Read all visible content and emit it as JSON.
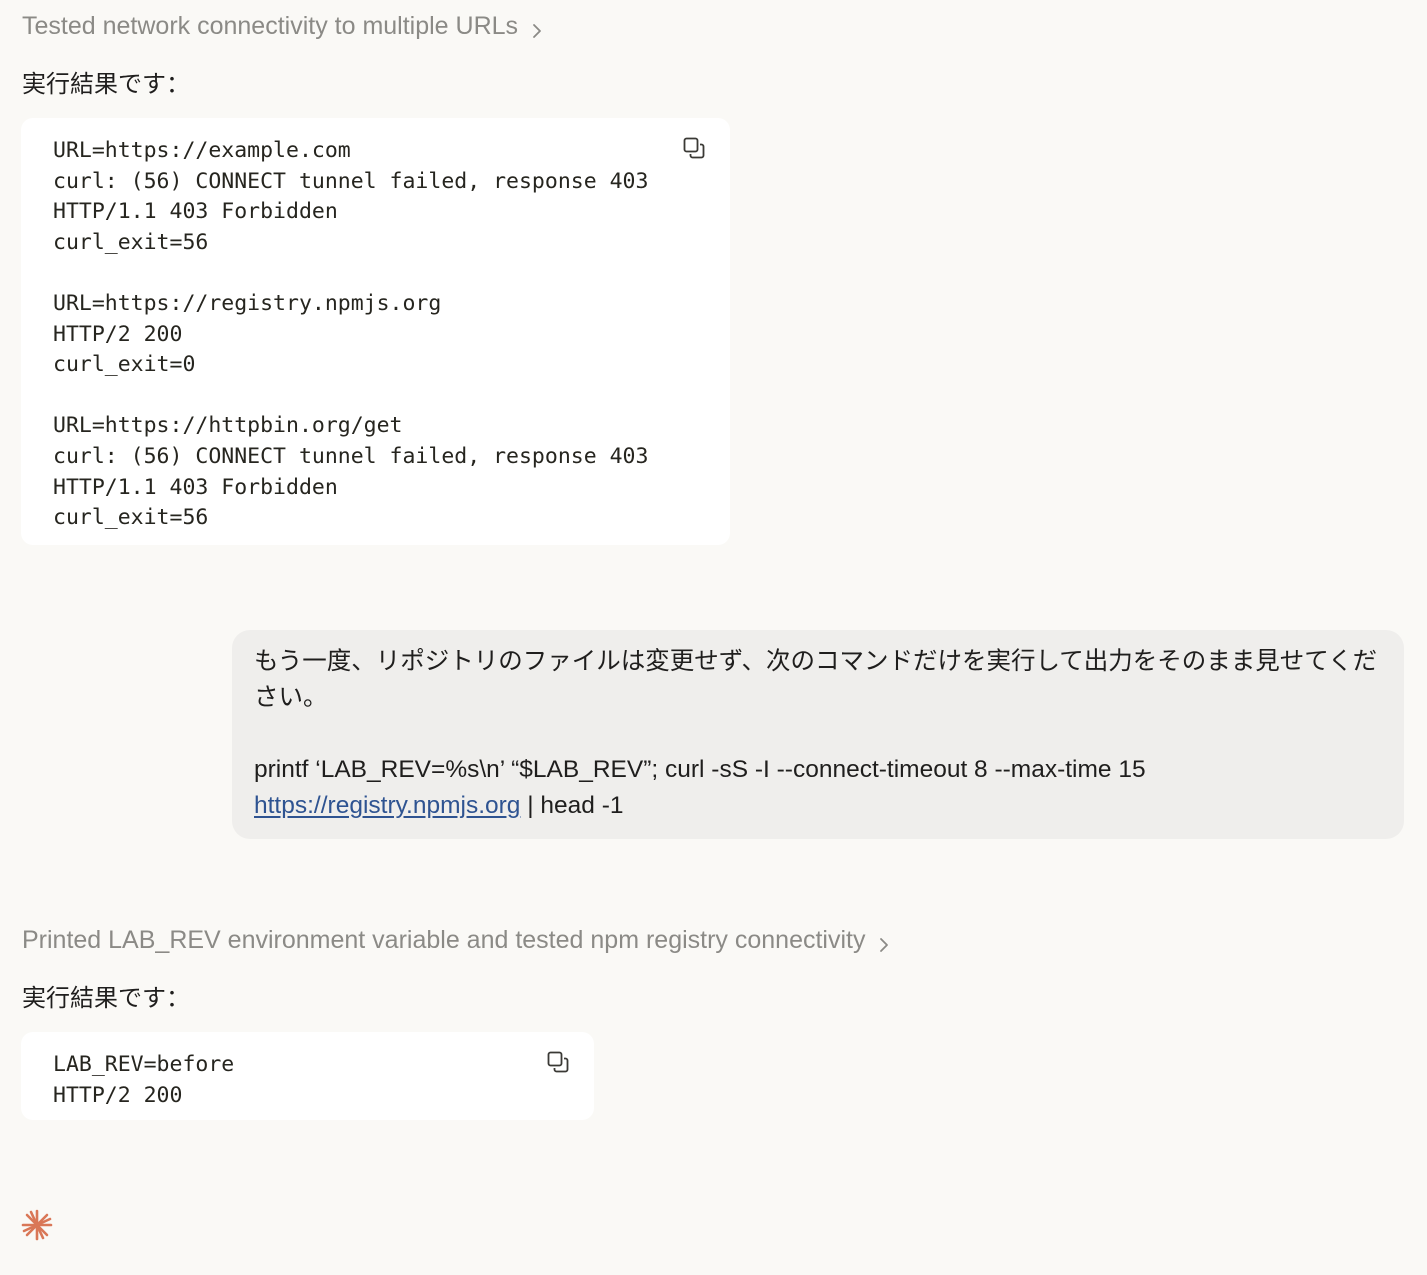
{
  "messages": {
    "first_tool": {
      "summary": "Tested network connectivity to multiple URLs",
      "reply": "実行結果です：",
      "code": "URL=https://example.com\ncurl: (56) CONNECT tunnel failed, response 403\nHTTP/1.1 403 Forbidden\ncurl_exit=56\n\nURL=https://registry.npmjs.org\nHTTP/2 200\ncurl_exit=0\n\nURL=https://httpbin.org/get\ncurl: (56) CONNECT tunnel failed, response 403\nHTTP/1.1 403 Forbidden\ncurl_exit=56"
    },
    "user": {
      "text": "もう一度、リポジトリのファイルは変更せず、次のコマンドだけを実行して出力をそのまま見せてください。",
      "command_part1": "printf ‘LAB_REV=%s\\n’ “$LAB_REV”; curl -sS -I --connect-timeout 8 --max-time 15",
      "command_link": "https://registry.npmjs.org",
      "command_part2": " | head -1"
    },
    "second_tool": {
      "summary": "Printed LAB_REV environment variable and tested npm registry connectivity",
      "reply": "実行結果です：",
      "code": "LAB_REV=before\nHTTP/2 200"
    }
  },
  "icons": {
    "chevron": "chevron-right-icon",
    "copy": "copy-icon",
    "assistant_mark": "spark-icon"
  },
  "colors": {
    "background": "#faf9f6",
    "link": "#2e5391",
    "accent": "#d97757",
    "bubble": "#efeeec"
  }
}
